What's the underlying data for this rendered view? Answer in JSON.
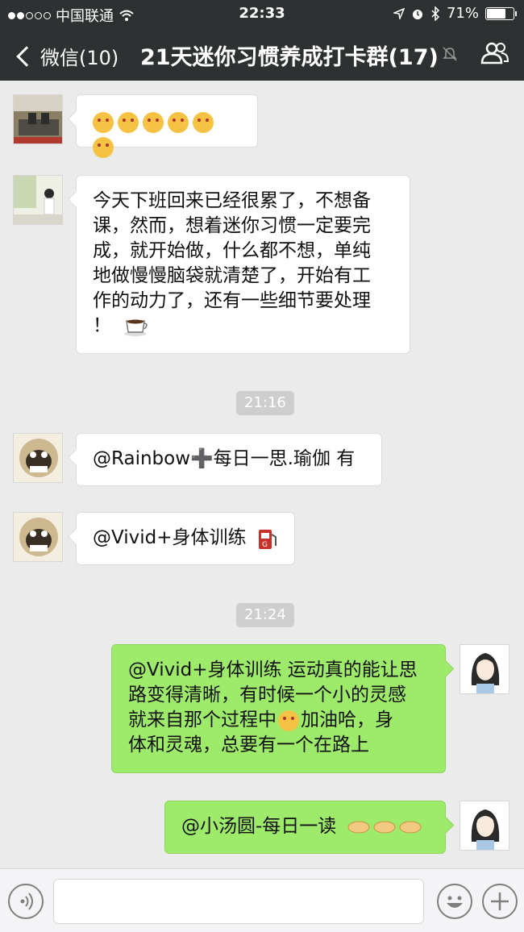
{
  "status_bar": {
    "carrier": "中国联通",
    "time": "22:33",
    "battery": "71%",
    "battery_level": 0.71
  },
  "nav": {
    "back_label": "微信(10)",
    "title": "21天迷你习惯养成打卡群(17)"
  },
  "messages": {
    "m1": {
      "emojis": [
        "hug-emoji",
        "hug-emoji",
        "blush-emoji",
        "heart-eyes-emoji",
        "heart-eyes-emoji",
        "heart-eyes-emoji"
      ]
    },
    "m2": {
      "lines": [
        "今天下班回来已经很累了，不想备",
        "课，然而，想着迷你习惯一定要完",
        "成，就开始做，什么都不想，单纯",
        "地做慢慢脑袋就清楚了，开始有工",
        "作的动力了，还有一些细节要处理",
        "！"
      ],
      "icon": "coffee-icon"
    },
    "time1": "21:16",
    "m3": {
      "text": "@Rainbow",
      "plus": "➕",
      "text2": "每日一思.瑜伽 有"
    },
    "m4": {
      "text": "@Vivid+身体训练",
      "icon": "fuel-pump-icon"
    },
    "time2": "21:24",
    "m5": {
      "lines": [
        "@Vivid+身体训练 运动真的能让思",
        "路变得清晰，有时候一个小的灵感",
        "就来自那个过程中",
        "加油哈，身",
        "体和灵魂，总要有一个在路上"
      ]
    },
    "m6": {
      "text": "@小汤圆-每日一读",
      "icon": "handshake-icon"
    }
  },
  "colors": {
    "nav_bg": "#2e3132",
    "chat_bg": "#ebebeb",
    "out_bubble": "#9eea6a"
  }
}
